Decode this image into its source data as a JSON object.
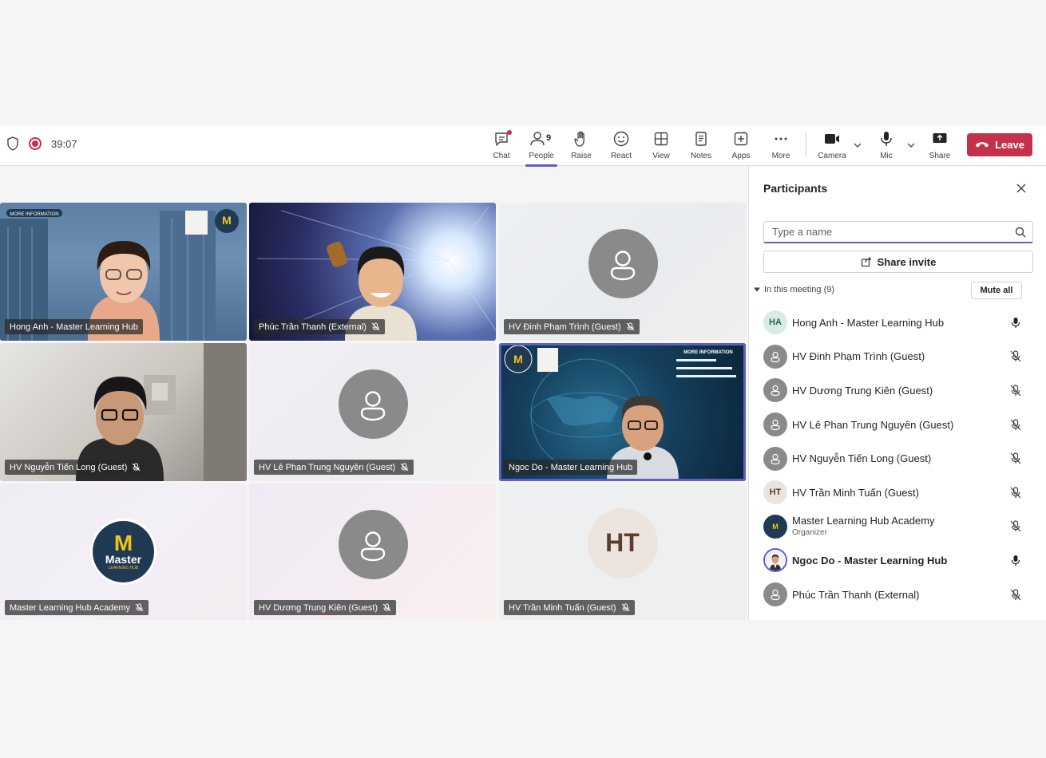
{
  "meeting": {
    "timer": "39:07",
    "people_count": "9"
  },
  "toolbar": {
    "chat": "Chat",
    "people": "People",
    "raise": "Raise",
    "react": "React",
    "view": "View",
    "notes": "Notes",
    "apps": "Apps",
    "more": "More",
    "camera": "Camera",
    "mic": "Mic",
    "share": "Share",
    "leave": "Leave"
  },
  "colors": {
    "accent": "#5b5fc7",
    "leave": "#c4314b"
  },
  "tiles": [
    {
      "name": "Hong Anh - Master Learning Hub",
      "muted": false,
      "kind": "video"
    },
    {
      "name": "Phúc Trần Thanh (External)",
      "muted": true,
      "kind": "video"
    },
    {
      "name": "HV Đinh Phạm Trình (Guest)",
      "muted": true,
      "kind": "avatar"
    },
    {
      "name": "HV Nguyễn Tiến Long (Guest)",
      "muted": true,
      "kind": "video"
    },
    {
      "name": "HV Lê Phan Trung Nguyên (Guest)",
      "muted": true,
      "kind": "avatar"
    },
    {
      "name": "Ngoc Do - Master Learning Hub",
      "muted": false,
      "kind": "video"
    },
    {
      "name": "Master Learning Hub Academy",
      "muted": true,
      "kind": "logo"
    },
    {
      "name": "HV Dương Trung Kiên (Guest)",
      "muted": true,
      "kind": "avatar"
    },
    {
      "name": "HV Trần Minh Tuấn (Guest)",
      "muted": true,
      "kind": "initials",
      "initials": "HT"
    }
  ],
  "tile_texts": {
    "more_info": "MORE INFORMATION",
    "logo_word": "Master",
    "logo_sub": "LEARNING HUB"
  },
  "panel": {
    "title": "Participants",
    "search_placeholder": "Type a name",
    "share_invite": "Share invite",
    "section": "In this meeting (9)",
    "mute_all": "Mute all",
    "participants": [
      {
        "name": "Hong Anh - Master Learning Hub",
        "initials": "HA",
        "muted": false
      },
      {
        "name": "HV Đinh Phạm Trình (Guest)",
        "muted": true
      },
      {
        "name": "HV Dương Trung Kiên (Guest)",
        "muted": true
      },
      {
        "name": "HV Lê Phan Trung Nguyên (Guest)",
        "muted": true
      },
      {
        "name": "HV Nguyễn Tiến Long (Guest)",
        "muted": true
      },
      {
        "name": "HV Trần Minh Tuấn (Guest)",
        "initials": "HT",
        "muted": true
      },
      {
        "name": "Master Learning Hub Academy",
        "role": "Organizer",
        "muted": true
      },
      {
        "name": "Ngoc Do - Master Learning Hub",
        "muted": false
      },
      {
        "name": "Phúc Trần Thanh (External)",
        "muted": true
      }
    ]
  }
}
